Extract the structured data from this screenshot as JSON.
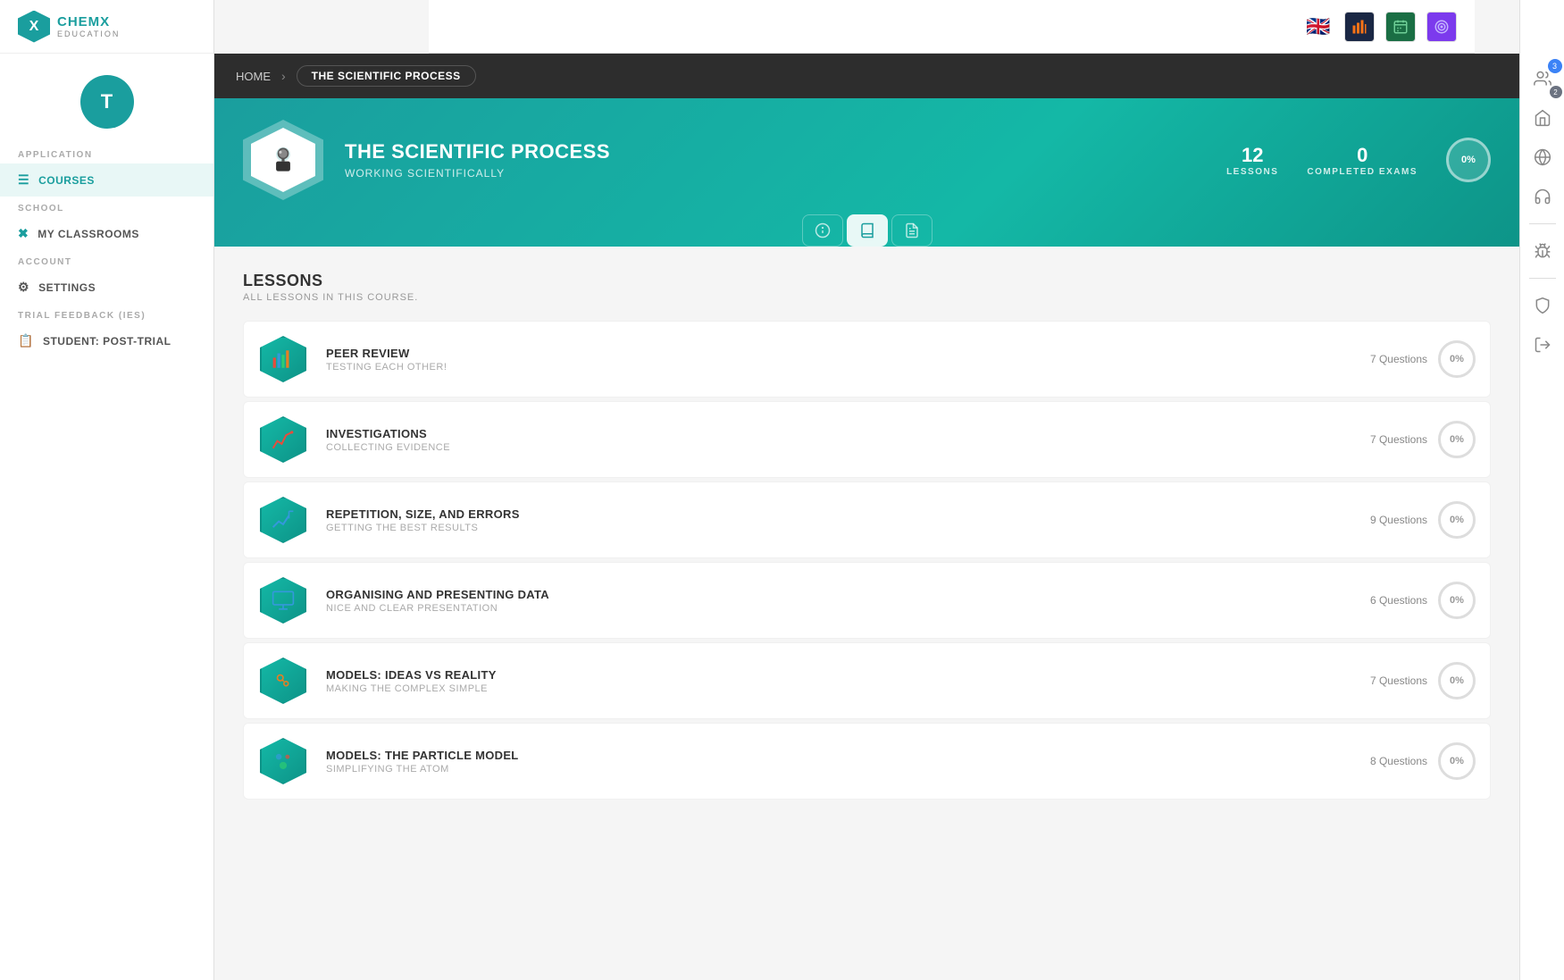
{
  "app": {
    "logo": {
      "x_letter": "X",
      "brand": "CHEMX",
      "tagline": "EDUCATION"
    },
    "avatar": {
      "letter": "T"
    }
  },
  "sidebar": {
    "sections": [
      {
        "label": "APPLICATION",
        "items": [
          {
            "id": "courses",
            "label": "COURSES",
            "icon": "📋",
            "active": true
          }
        ]
      },
      {
        "label": "SCHOOL",
        "items": [
          {
            "id": "my-classrooms",
            "label": "MY CLASSROOMS",
            "icon": "✖",
            "active": false
          }
        ]
      },
      {
        "label": "ACCOUNT",
        "items": [
          {
            "id": "settings",
            "label": "SETTINGS",
            "icon": "⚙",
            "active": false
          }
        ]
      },
      {
        "label": "TRIAL FEEDBACK (IES)",
        "items": [
          {
            "id": "student-post-trial",
            "label": "STUDENT: POST-TRIAL",
            "icon": "📋",
            "active": false
          }
        ]
      }
    ]
  },
  "breadcrumb": {
    "home": "HOME",
    "current": "THE SCIENTIFIC PROCESS"
  },
  "course": {
    "title": "THE SCIENTIFIC PROCESS",
    "subtitle": "WORKING SCIENTIFICALLY",
    "lessons_count": 12,
    "lessons_label": "LESSONS",
    "completed_exams": 0,
    "completed_exams_label": "COMPLETED EXAMS",
    "progress": "0%",
    "tabs": [
      {
        "id": "info",
        "icon": "ℹ",
        "active": false
      },
      {
        "id": "book",
        "icon": "📖",
        "active": true
      },
      {
        "id": "file",
        "icon": "📄",
        "active": false
      }
    ]
  },
  "lessons": {
    "title": "LESSONS",
    "subtitle": "ALL LESSONS IN THIS COURSE.",
    "items": [
      {
        "id": "peer-review",
        "name": "PEER REVIEW",
        "description": "TESTING EACH OTHER!",
        "questions": 7,
        "progress": "0%",
        "icon": "📊"
      },
      {
        "id": "investigations",
        "name": "INVESTIGATIONS",
        "description": "COLLECTING EVIDENCE",
        "questions": 7,
        "progress": "0%",
        "icon": "📈"
      },
      {
        "id": "repetition-size-errors",
        "name": "REPETITION, SIZE, AND ERRORS",
        "description": "GETTING THE BEST RESULTS",
        "questions": 9,
        "progress": "0%",
        "icon": "📉"
      },
      {
        "id": "organising-presenting-data",
        "name": "ORGANISING AND PRESENTING DATA",
        "description": "NICE AND CLEAR PRESENTATION",
        "questions": 6,
        "progress": "0%",
        "icon": "🖥"
      },
      {
        "id": "models-ideas-vs-reality",
        "name": "MODELS: IDEAS VS REALITY",
        "description": "MAKING THE COMPLEX SIMPLE",
        "questions": 7,
        "progress": "0%",
        "icon": "⚙"
      },
      {
        "id": "models-particle-model",
        "name": "MODELS: THE PARTICLE MODEL",
        "description": "SIMPLIFYING THE ATOM",
        "questions": 8,
        "progress": "0%",
        "icon": "🔬"
      }
    ],
    "questions_suffix": "Questions"
  },
  "topbar": {
    "icons": [
      "🌐🇬🇧",
      "📊",
      "🗓",
      "🎯"
    ]
  },
  "right_sidebar": {
    "icons": [
      {
        "id": "home",
        "symbol": "🏠"
      },
      {
        "id": "globe",
        "symbol": "🌐"
      },
      {
        "id": "headset",
        "symbol": "🎧"
      },
      {
        "id": "bug",
        "symbol": "🐛"
      },
      {
        "id": "shield",
        "symbol": "🛡"
      },
      {
        "id": "logout",
        "symbol": "🚪"
      }
    ],
    "badge_count_blue": "3",
    "badge_count_gray": "2"
  }
}
